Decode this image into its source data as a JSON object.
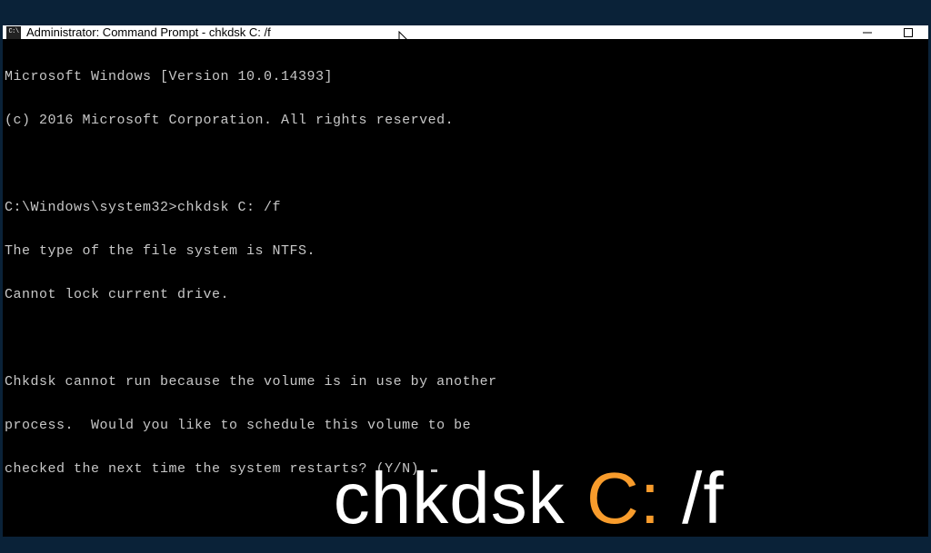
{
  "window": {
    "title": "Administrator: Command Prompt - chkdsk  C: /f",
    "icon_glyph": "C:\\"
  },
  "terminal": {
    "lines": [
      "Microsoft Windows [Version 10.0.14393]",
      "(c) 2016 Microsoft Corporation. All rights reserved.",
      "",
      "C:\\Windows\\system32>chkdsk C: /f",
      "The type of the file system is NTFS.",
      "Cannot lock current drive.",
      "",
      "Chkdsk cannot run because the volume is in use by another",
      "process.  Would you like to schedule this volume to be",
      "checked the next time the system restarts? (Y/N) "
    ]
  },
  "overlay": {
    "part1": "chkdsk ",
    "accent": "C:",
    "part2": " /f"
  }
}
